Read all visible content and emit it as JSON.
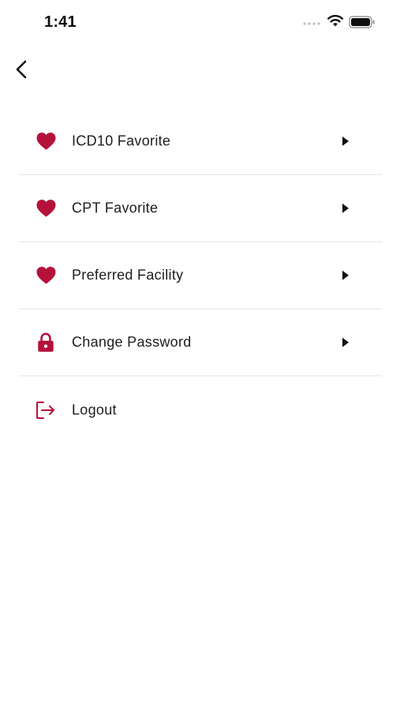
{
  "status_bar": {
    "time": "1:41",
    "signal_icon": "signal-dots-icon",
    "wifi_icon": "wifi-icon",
    "battery_icon": "battery-icon"
  },
  "nav": {
    "back_icon": "chevron-left-icon"
  },
  "colors": {
    "accent": "#b5123b",
    "text": "#1d1d1d",
    "divider": "#e6e6e6",
    "background": "#ffffff"
  },
  "menu": {
    "items": [
      {
        "label": "ICD10 Favorite",
        "icon": "heart-icon",
        "has_chevron": true
      },
      {
        "label": "CPT Favorite",
        "icon": "heart-icon",
        "has_chevron": true
      },
      {
        "label": "Preferred Facility",
        "icon": "heart-icon",
        "has_chevron": true
      },
      {
        "label": "Change Password",
        "icon": "lock-icon",
        "has_chevron": true
      },
      {
        "label": "Logout",
        "icon": "logout-icon",
        "has_chevron": false
      }
    ]
  }
}
